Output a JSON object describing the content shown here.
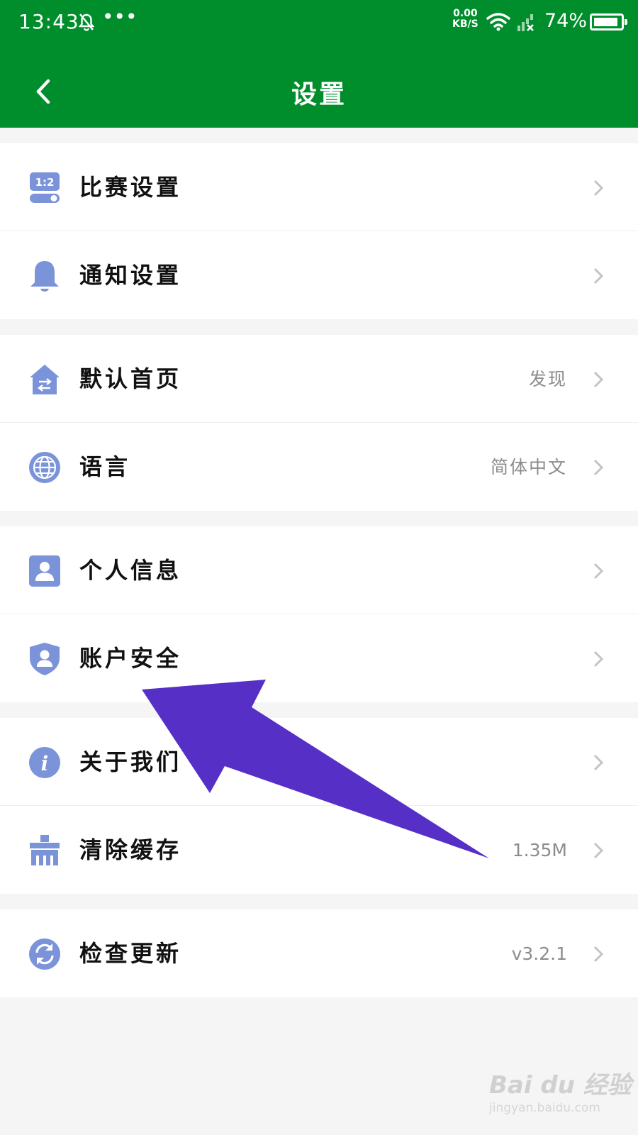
{
  "status_bar": {
    "time": "13:43",
    "dots": "•••",
    "net_speed_value": "0.00",
    "net_speed_unit": "KB/S",
    "battery": "74%"
  },
  "header": {
    "title": "设置"
  },
  "groups": [
    {
      "items": [
        {
          "label": "比赛设置",
          "icon": "score-settings-icon",
          "value": ""
        },
        {
          "label": "通知设置",
          "icon": "bell-icon",
          "value": ""
        }
      ]
    },
    {
      "items": [
        {
          "label": "默认首页",
          "icon": "home-switch-icon",
          "value": "发现"
        },
        {
          "label": "语言",
          "icon": "globe-icon",
          "value": "简体中文"
        }
      ]
    },
    {
      "items": [
        {
          "label": "个人信息",
          "icon": "profile-card-icon",
          "value": ""
        },
        {
          "label": "账户安全",
          "icon": "shield-user-icon",
          "value": ""
        }
      ]
    },
    {
      "items": [
        {
          "label": "关于我们",
          "icon": "info-icon",
          "value": ""
        },
        {
          "label": "清除缓存",
          "icon": "broom-icon",
          "value": "1.35M"
        }
      ]
    },
    {
      "items": [
        {
          "label": "检查更新",
          "icon": "refresh-icon",
          "value": "v3.2.1"
        }
      ]
    }
  ],
  "colors": {
    "header": "#008e2c",
    "icon": "#7b93d9",
    "arrow": "#5630c6"
  },
  "watermark": {
    "brand": "Bai du 经验",
    "url": "jingyan.baidu.com"
  }
}
